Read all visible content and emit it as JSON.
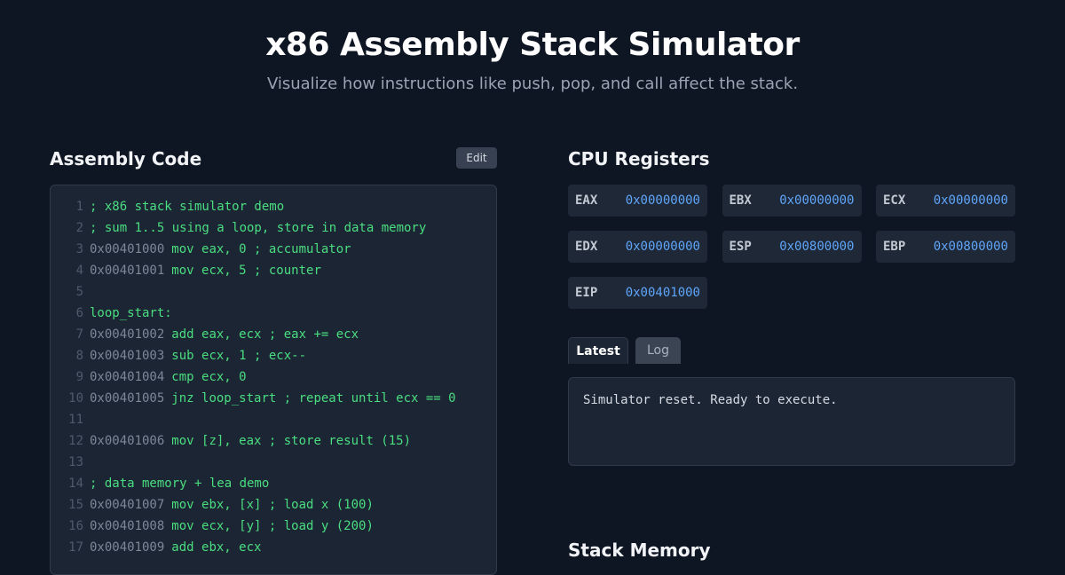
{
  "header": {
    "title": "x86 Assembly Stack Simulator",
    "subtitle": "Visualize how instructions like push, pop, and call affect the stack."
  },
  "code_section": {
    "title": "Assembly Code",
    "edit_label": "Edit",
    "lines": [
      {
        "num": "1",
        "addr": "",
        "text": "; x86 stack simulator demo"
      },
      {
        "num": "2",
        "addr": "",
        "text": "; sum 1..5 using a loop, store in data memory"
      },
      {
        "num": "3",
        "addr": "0x00401000",
        "text": "mov eax, 0 ; accumulator"
      },
      {
        "num": "4",
        "addr": "0x00401001",
        "text": "mov ecx, 5 ; counter"
      },
      {
        "num": "5",
        "addr": "",
        "text": ""
      },
      {
        "num": "6",
        "addr": "",
        "text": "loop_start:"
      },
      {
        "num": "7",
        "addr": "0x00401002",
        "text": "add eax, ecx ; eax += ecx"
      },
      {
        "num": "8",
        "addr": "0x00401003",
        "text": "sub ecx, 1 ; ecx--"
      },
      {
        "num": "9",
        "addr": "0x00401004",
        "text": "cmp ecx, 0"
      },
      {
        "num": "10",
        "addr": "0x00401005",
        "text": "jnz loop_start ; repeat until ecx == 0"
      },
      {
        "num": "11",
        "addr": "",
        "text": ""
      },
      {
        "num": "12",
        "addr": "0x00401006",
        "text": "mov [z], eax ; store result (15)"
      },
      {
        "num": "13",
        "addr": "",
        "text": ""
      },
      {
        "num": "14",
        "addr": "",
        "text": "; data memory + lea demo"
      },
      {
        "num": "15",
        "addr": "0x00401007",
        "text": "mov ebx, [x] ; load x (100)"
      },
      {
        "num": "16",
        "addr": "0x00401008",
        "text": "mov ecx, [y] ; load y (200)"
      },
      {
        "num": "17",
        "addr": "0x00401009",
        "text": "add ebx, ecx"
      }
    ]
  },
  "registers_section": {
    "title": "CPU Registers",
    "registers": [
      {
        "name": "EAX",
        "value": "0x00000000"
      },
      {
        "name": "EBX",
        "value": "0x00000000"
      },
      {
        "name": "ECX",
        "value": "0x00000000"
      },
      {
        "name": "EDX",
        "value": "0x00000000"
      },
      {
        "name": "ESP",
        "value": "0x00800000"
      },
      {
        "name": "EBP",
        "value": "0x00800000"
      },
      {
        "name": "EIP",
        "value": "0x00401000"
      }
    ]
  },
  "output": {
    "tabs": [
      {
        "label": "Latest",
        "active": true
      },
      {
        "label": "Log",
        "active": false
      }
    ],
    "message": "Simulator reset. Ready to execute."
  },
  "stack_section": {
    "title": "Stack Memory"
  },
  "colors": {
    "background": "#0f1623",
    "panel": "#1c2534",
    "instruction": "#4ade80",
    "register_value": "#60a5fa"
  }
}
